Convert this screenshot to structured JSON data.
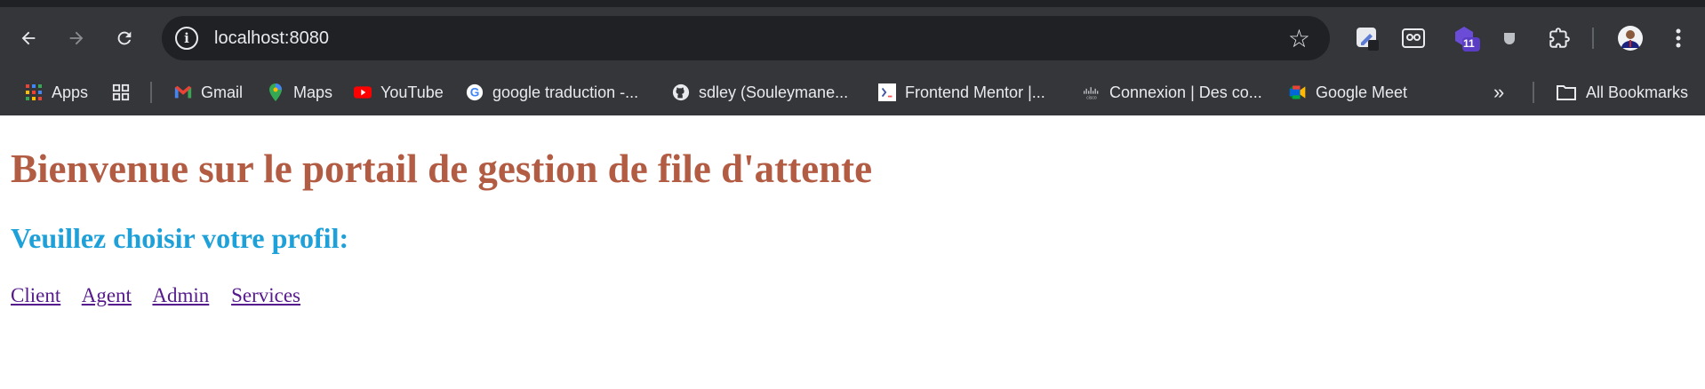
{
  "browser": {
    "url": "localhost:8080",
    "extensions": {
      "badge_count": "11"
    },
    "bookmarks": [
      {
        "label": "Apps",
        "icon": "apps-grid-icon"
      },
      {
        "label": "",
        "icon": "tab-groups-icon"
      },
      {
        "label": "Gmail",
        "icon": "gmail-icon"
      },
      {
        "label": "Maps",
        "icon": "maps-pin-icon"
      },
      {
        "label": "YouTube",
        "icon": "youtube-icon"
      },
      {
        "label": "google traduction -...",
        "icon": "google-icon"
      },
      {
        "label": "sdley (Souleymane...",
        "icon": "github-icon"
      },
      {
        "label": "Frontend Mentor |...",
        "icon": "frontend-mentor-icon"
      },
      {
        "label": "Connexion | Des co...",
        "icon": "cisco-icon"
      },
      {
        "label": "Google Meet",
        "icon": "google-meet-icon"
      }
    ],
    "all_bookmarks_label": "All Bookmarks"
  },
  "page": {
    "heading": "Bienvenue sur le portail de gestion de file d'attente",
    "subheading": "Veuillez choisir votre profil:",
    "links": [
      "Client",
      "Agent",
      "Admin",
      "Services"
    ]
  },
  "colors": {
    "heading": "#b35c44",
    "subheading": "#1ea0d8",
    "link": "#551a8b",
    "chrome_bg": "#35363a"
  }
}
